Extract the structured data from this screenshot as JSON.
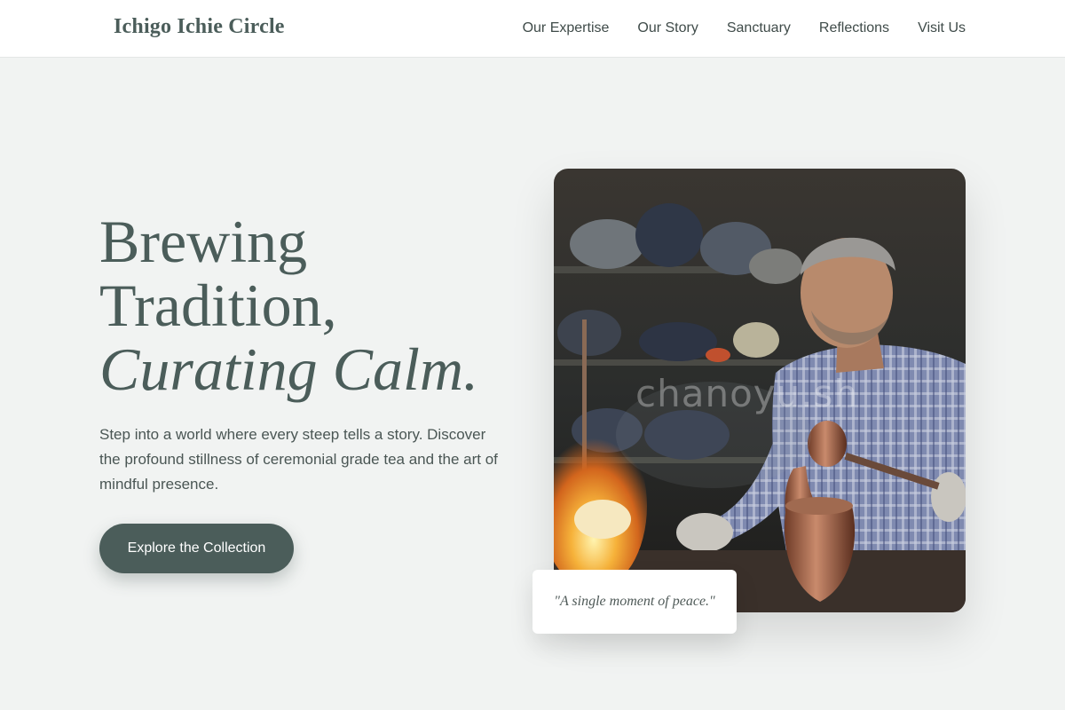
{
  "header": {
    "brand": "Ichigo Ichie Circle",
    "nav": [
      "Our Expertise",
      "Our Story",
      "Sanctuary",
      "Reflections",
      "Visit Us"
    ]
  },
  "hero": {
    "headline_line1": "Brewing",
    "headline_line2": "Tradition,",
    "headline_line3": "Curating Calm.",
    "lede": "Step into a world where every steep tells a story. Discover the profound stillness of ceremonial grade tea and the art of mindful presence.",
    "cta_label": "Explore the Collection",
    "photo_watermark": "chanoyu.sh",
    "quote": "\"A single moment of peace.\""
  },
  "colors": {
    "accent": "#4b5d5a",
    "background": "#f1f3f2",
    "header_bg": "#ffffff"
  },
  "icons": []
}
